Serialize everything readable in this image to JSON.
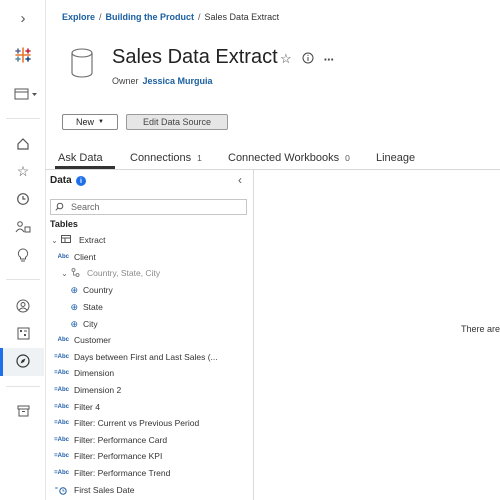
{
  "breadcrumb": {
    "root": "Explore",
    "parent": "Building the Product",
    "current": "Sales Data Extract"
  },
  "header": {
    "title": "Sales Data Extract",
    "owner_label": "Owner",
    "owner_name": "Jessica Murguia"
  },
  "actions": {
    "new_label": "New",
    "edit_label": "Edit Data Source"
  },
  "tabs": [
    {
      "label": "Ask Data",
      "count": ""
    },
    {
      "label": "Connections",
      "count": "1"
    },
    {
      "label": "Connected Workbooks",
      "count": "0"
    },
    {
      "label": "Lineage",
      "count": ""
    }
  ],
  "data_pane": {
    "title": "Data",
    "search_placeholder": "Search",
    "tables_label": "Tables",
    "items": [
      {
        "label": "Extract",
        "icon": "table-icon"
      },
      {
        "label": "Client",
        "icon": "Abc"
      },
      {
        "label": "Country, State, City",
        "icon": "hierarchy-icon"
      },
      {
        "label": "Country",
        "icon": "globe-icon"
      },
      {
        "label": "State",
        "icon": "globe-icon"
      },
      {
        "label": "City",
        "icon": "globe-icon"
      },
      {
        "label": "Customer",
        "icon": "Abc"
      },
      {
        "label": "Days between First and Last Sales (...",
        "icon": "=Abc"
      },
      {
        "label": "Dimension",
        "icon": "=Abc"
      },
      {
        "label": "Dimension 2",
        "icon": "=Abc"
      },
      {
        "label": "Filter 4",
        "icon": "=Abc"
      },
      {
        "label": "Filter: Current vs Previous Period",
        "icon": "=Abc"
      },
      {
        "label": "Filter: Performance Card",
        "icon": "=Abc"
      },
      {
        "label": "Filter: Performance KPI",
        "icon": "=Abc"
      },
      {
        "label": "Filter: Performance Trend",
        "icon": "=Abc"
      },
      {
        "label": "First Sales Date",
        "icon": "calc-date-icon"
      }
    ]
  },
  "main": {
    "message": "There are"
  }
}
